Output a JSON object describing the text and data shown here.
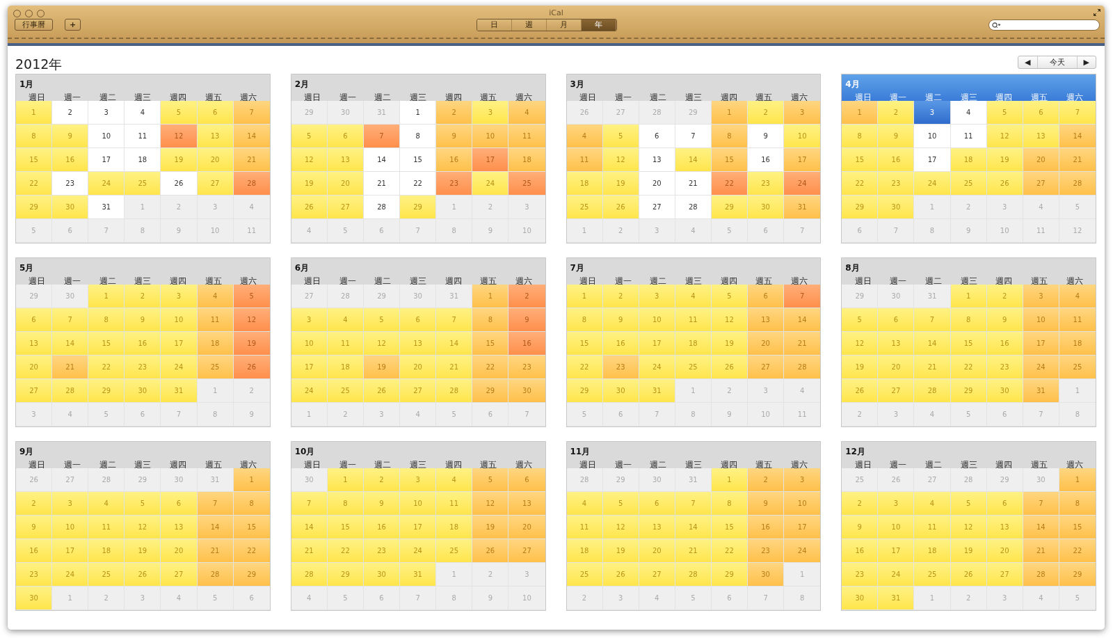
{
  "window": {
    "title": "iCal"
  },
  "toolbar": {
    "calendars_button": "行事曆",
    "add_button": "+",
    "views": [
      {
        "label": "日",
        "selected": false
      },
      {
        "label": "週",
        "selected": false
      },
      {
        "label": "月",
        "selected": false
      },
      {
        "label": "年",
        "selected": true
      }
    ]
  },
  "year_title": "2012年",
  "nav": {
    "prev": "◀",
    "today": "今天",
    "next": "▶"
  },
  "months": [
    {
      "title": "1月",
      "selected": false,
      "weekdays": [
        "週日",
        "週一",
        "週二",
        "週三",
        "週四",
        "週五",
        "週六"
      ],
      "days": [
        {
          "day": "1",
          "kind": "low"
        },
        {
          "day": "2",
          "kind": "free"
        },
        {
          "day": "3",
          "kind": "free"
        },
        {
          "day": "4",
          "kind": "free"
        },
        {
          "day": "5",
          "kind": "low"
        },
        {
          "day": "6",
          "kind": "low"
        },
        {
          "day": "7",
          "kind": "mid"
        },
        {
          "day": "8",
          "kind": "low"
        },
        {
          "day": "9",
          "kind": "low"
        },
        {
          "day": "10",
          "kind": "free"
        },
        {
          "day": "11",
          "kind": "free"
        },
        {
          "day": "12",
          "kind": "high"
        },
        {
          "day": "13",
          "kind": "low"
        },
        {
          "day": "14",
          "kind": "mid"
        },
        {
          "day": "15",
          "kind": "low"
        },
        {
          "day": "16",
          "kind": "low"
        },
        {
          "day": "17",
          "kind": "free"
        },
        {
          "day": "18",
          "kind": "free"
        },
        {
          "day": "19",
          "kind": "low"
        },
        {
          "day": "20",
          "kind": "low"
        },
        {
          "day": "21",
          "kind": "mid"
        },
        {
          "day": "22",
          "kind": "low"
        },
        {
          "day": "23",
          "kind": "free"
        },
        {
          "day": "24",
          "kind": "low"
        },
        {
          "day": "25",
          "kind": "low"
        },
        {
          "day": "26",
          "kind": "free"
        },
        {
          "day": "27",
          "kind": "low"
        },
        {
          "day": "28",
          "kind": "high"
        },
        {
          "day": "29",
          "kind": "low"
        },
        {
          "day": "30",
          "kind": "low"
        },
        {
          "day": "31",
          "kind": "free"
        },
        {
          "day": "1",
          "kind": "out"
        },
        {
          "day": "2",
          "kind": "out"
        },
        {
          "day": "3",
          "kind": "out"
        },
        {
          "day": "4",
          "kind": "out"
        },
        {
          "day": "5",
          "kind": "out"
        },
        {
          "day": "6",
          "kind": "out"
        },
        {
          "day": "7",
          "kind": "out"
        },
        {
          "day": "8",
          "kind": "out"
        },
        {
          "day": "9",
          "kind": "out"
        },
        {
          "day": "10",
          "kind": "out"
        },
        {
          "day": "11",
          "kind": "out"
        }
      ]
    },
    {
      "title": "2月",
      "selected": false,
      "weekdays": [
        "週日",
        "週一",
        "週二",
        "週三",
        "週四",
        "週五",
        "週六"
      ],
      "days": [
        {
          "day": "29",
          "kind": "out"
        },
        {
          "day": "30",
          "kind": "out"
        },
        {
          "day": "31",
          "kind": "out"
        },
        {
          "day": "1",
          "kind": "free"
        },
        {
          "day": "2",
          "kind": "mid"
        },
        {
          "day": "3",
          "kind": "low"
        },
        {
          "day": "4",
          "kind": "mid"
        },
        {
          "day": "5",
          "kind": "low"
        },
        {
          "day": "6",
          "kind": "low"
        },
        {
          "day": "7",
          "kind": "high"
        },
        {
          "day": "8",
          "kind": "free"
        },
        {
          "day": "9",
          "kind": "mid"
        },
        {
          "day": "10",
          "kind": "mid"
        },
        {
          "day": "11",
          "kind": "mid"
        },
        {
          "day": "12",
          "kind": "low"
        },
        {
          "day": "13",
          "kind": "low"
        },
        {
          "day": "14",
          "kind": "free"
        },
        {
          "day": "15",
          "kind": "free"
        },
        {
          "day": "16",
          "kind": "mid"
        },
        {
          "day": "17",
          "kind": "high"
        },
        {
          "day": "18",
          "kind": "mid"
        },
        {
          "day": "19",
          "kind": "low"
        },
        {
          "day": "20",
          "kind": "low"
        },
        {
          "day": "21",
          "kind": "free"
        },
        {
          "day": "22",
          "kind": "free"
        },
        {
          "day": "23",
          "kind": "high"
        },
        {
          "day": "24",
          "kind": "low"
        },
        {
          "day": "25",
          "kind": "high"
        },
        {
          "day": "26",
          "kind": "low"
        },
        {
          "day": "27",
          "kind": "low"
        },
        {
          "day": "28",
          "kind": "free"
        },
        {
          "day": "29",
          "kind": "low"
        },
        {
          "day": "1",
          "kind": "out"
        },
        {
          "day": "2",
          "kind": "out"
        },
        {
          "day": "3",
          "kind": "out"
        },
        {
          "day": "4",
          "kind": "out"
        },
        {
          "day": "5",
          "kind": "out"
        },
        {
          "day": "6",
          "kind": "out"
        },
        {
          "day": "7",
          "kind": "out"
        },
        {
          "day": "8",
          "kind": "out"
        },
        {
          "day": "9",
          "kind": "out"
        },
        {
          "day": "10",
          "kind": "out"
        }
      ]
    },
    {
      "title": "3月",
      "selected": false,
      "weekdays": [
        "週日",
        "週一",
        "週二",
        "週三",
        "週四",
        "週五",
        "週六"
      ],
      "days": [
        {
          "day": "26",
          "kind": "out"
        },
        {
          "day": "27",
          "kind": "out"
        },
        {
          "day": "28",
          "kind": "out"
        },
        {
          "day": "29",
          "kind": "out"
        },
        {
          "day": "1",
          "kind": "mid"
        },
        {
          "day": "2",
          "kind": "low"
        },
        {
          "day": "3",
          "kind": "mid"
        },
        {
          "day": "4",
          "kind": "mid"
        },
        {
          "day": "5",
          "kind": "low"
        },
        {
          "day": "6",
          "kind": "free"
        },
        {
          "day": "7",
          "kind": "free"
        },
        {
          "day": "8",
          "kind": "mid"
        },
        {
          "day": "9",
          "kind": "free"
        },
        {
          "day": "10",
          "kind": "low"
        },
        {
          "day": "11",
          "kind": "mid"
        },
        {
          "day": "12",
          "kind": "low"
        },
        {
          "day": "13",
          "kind": "free"
        },
        {
          "day": "14",
          "kind": "low"
        },
        {
          "day": "15",
          "kind": "mid"
        },
        {
          "day": "16",
          "kind": "free"
        },
        {
          "day": "17",
          "kind": "mid"
        },
        {
          "day": "18",
          "kind": "low"
        },
        {
          "day": "19",
          "kind": "low"
        },
        {
          "day": "20",
          "kind": "free"
        },
        {
          "day": "21",
          "kind": "free"
        },
        {
          "day": "22",
          "kind": "high"
        },
        {
          "day": "23",
          "kind": "low"
        },
        {
          "day": "24",
          "kind": "high"
        },
        {
          "day": "25",
          "kind": "low"
        },
        {
          "day": "26",
          "kind": "low"
        },
        {
          "day": "27",
          "kind": "free"
        },
        {
          "day": "28",
          "kind": "free"
        },
        {
          "day": "29",
          "kind": "low"
        },
        {
          "day": "30",
          "kind": "low"
        },
        {
          "day": "31",
          "kind": "mid"
        },
        {
          "day": "1",
          "kind": "out"
        },
        {
          "day": "2",
          "kind": "out"
        },
        {
          "day": "3",
          "kind": "out"
        },
        {
          "day": "4",
          "kind": "out"
        },
        {
          "day": "5",
          "kind": "out"
        },
        {
          "day": "6",
          "kind": "out"
        },
        {
          "day": "7",
          "kind": "out"
        }
      ]
    },
    {
      "title": "4月",
      "selected": true,
      "weekdays": [
        "週日",
        "週一",
        "週二",
        "週三",
        "週四",
        "週五",
        "週六"
      ],
      "days": [
        {
          "day": "1",
          "kind": "mid"
        },
        {
          "day": "2",
          "kind": "low"
        },
        {
          "day": "3",
          "kind": "today"
        },
        {
          "day": "4",
          "kind": "free"
        },
        {
          "day": "5",
          "kind": "low"
        },
        {
          "day": "6",
          "kind": "low"
        },
        {
          "day": "7",
          "kind": "low"
        },
        {
          "day": "8",
          "kind": "low"
        },
        {
          "day": "9",
          "kind": "low"
        },
        {
          "day": "10",
          "kind": "free"
        },
        {
          "day": "11",
          "kind": "free"
        },
        {
          "day": "12",
          "kind": "low"
        },
        {
          "day": "13",
          "kind": "low"
        },
        {
          "day": "14",
          "kind": "mid"
        },
        {
          "day": "15",
          "kind": "low"
        },
        {
          "day": "16",
          "kind": "low"
        },
        {
          "day": "17",
          "kind": "free"
        },
        {
          "day": "18",
          "kind": "low"
        },
        {
          "day": "19",
          "kind": "low"
        },
        {
          "day": "20",
          "kind": "mid"
        },
        {
          "day": "21",
          "kind": "mid"
        },
        {
          "day": "22",
          "kind": "low"
        },
        {
          "day": "23",
          "kind": "low"
        },
        {
          "day": "24",
          "kind": "low"
        },
        {
          "day": "25",
          "kind": "low"
        },
        {
          "day": "26",
          "kind": "low"
        },
        {
          "day": "27",
          "kind": "mid"
        },
        {
          "day": "28",
          "kind": "mid"
        },
        {
          "day": "29",
          "kind": "low"
        },
        {
          "day": "30",
          "kind": "low"
        },
        {
          "day": "1",
          "kind": "out"
        },
        {
          "day": "2",
          "kind": "out"
        },
        {
          "day": "3",
          "kind": "out"
        },
        {
          "day": "4",
          "kind": "out"
        },
        {
          "day": "5",
          "kind": "out"
        },
        {
          "day": "6",
          "kind": "out"
        },
        {
          "day": "7",
          "kind": "out"
        },
        {
          "day": "8",
          "kind": "out"
        },
        {
          "day": "9",
          "kind": "out"
        },
        {
          "day": "10",
          "kind": "out"
        },
        {
          "day": "11",
          "kind": "out"
        },
        {
          "day": "12",
          "kind": "out"
        }
      ]
    },
    {
      "title": "5月",
      "selected": false,
      "weekdays": [
        "週日",
        "週一",
        "週二",
        "週三",
        "週四",
        "週五",
        "週六"
      ],
      "days": [
        {
          "day": "29",
          "kind": "out"
        },
        {
          "day": "30",
          "kind": "out"
        },
        {
          "day": "1",
          "kind": "low"
        },
        {
          "day": "2",
          "kind": "low"
        },
        {
          "day": "3",
          "kind": "low"
        },
        {
          "day": "4",
          "kind": "mid"
        },
        {
          "day": "5",
          "kind": "high"
        },
        {
          "day": "6",
          "kind": "low"
        },
        {
          "day": "7",
          "kind": "low"
        },
        {
          "day": "8",
          "kind": "low"
        },
        {
          "day": "9",
          "kind": "low"
        },
        {
          "day": "10",
          "kind": "low"
        },
        {
          "day": "11",
          "kind": "mid"
        },
        {
          "day": "12",
          "kind": "high"
        },
        {
          "day": "13",
          "kind": "low"
        },
        {
          "day": "14",
          "kind": "low"
        },
        {
          "day": "15",
          "kind": "low"
        },
        {
          "day": "16",
          "kind": "low"
        },
        {
          "day": "17",
          "kind": "low"
        },
        {
          "day": "18",
          "kind": "mid"
        },
        {
          "day": "19",
          "kind": "high"
        },
        {
          "day": "20",
          "kind": "low"
        },
        {
          "day": "21",
          "kind": "mid"
        },
        {
          "day": "22",
          "kind": "low"
        },
        {
          "day": "23",
          "kind": "low"
        },
        {
          "day": "24",
          "kind": "low"
        },
        {
          "day": "25",
          "kind": "mid"
        },
        {
          "day": "26",
          "kind": "high"
        },
        {
          "day": "27",
          "kind": "low"
        },
        {
          "day": "28",
          "kind": "low"
        },
        {
          "day": "29",
          "kind": "low"
        },
        {
          "day": "30",
          "kind": "low"
        },
        {
          "day": "31",
          "kind": "low"
        },
        {
          "day": "1",
          "kind": "out"
        },
        {
          "day": "2",
          "kind": "out"
        },
        {
          "day": "3",
          "kind": "out"
        },
        {
          "day": "4",
          "kind": "out"
        },
        {
          "day": "5",
          "kind": "out"
        },
        {
          "day": "6",
          "kind": "out"
        },
        {
          "day": "7",
          "kind": "out"
        },
        {
          "day": "8",
          "kind": "out"
        },
        {
          "day": "9",
          "kind": "out"
        }
      ]
    },
    {
      "title": "6月",
      "selected": false,
      "weekdays": [
        "週日",
        "週一",
        "週二",
        "週三",
        "週四",
        "週五",
        "週六"
      ],
      "days": [
        {
          "day": "27",
          "kind": "out"
        },
        {
          "day": "28",
          "kind": "out"
        },
        {
          "day": "29",
          "kind": "out"
        },
        {
          "day": "30",
          "kind": "out"
        },
        {
          "day": "31",
          "kind": "out"
        },
        {
          "day": "1",
          "kind": "mid"
        },
        {
          "day": "2",
          "kind": "high"
        },
        {
          "day": "3",
          "kind": "low"
        },
        {
          "day": "4",
          "kind": "low"
        },
        {
          "day": "5",
          "kind": "low"
        },
        {
          "day": "6",
          "kind": "low"
        },
        {
          "day": "7",
          "kind": "low"
        },
        {
          "day": "8",
          "kind": "mid"
        },
        {
          "day": "9",
          "kind": "high"
        },
        {
          "day": "10",
          "kind": "low"
        },
        {
          "day": "11",
          "kind": "low"
        },
        {
          "day": "12",
          "kind": "low"
        },
        {
          "day": "13",
          "kind": "low"
        },
        {
          "day": "14",
          "kind": "low"
        },
        {
          "day": "15",
          "kind": "mid"
        },
        {
          "day": "16",
          "kind": "high"
        },
        {
          "day": "17",
          "kind": "low"
        },
        {
          "day": "18",
          "kind": "low"
        },
        {
          "day": "19",
          "kind": "mid"
        },
        {
          "day": "20",
          "kind": "low"
        },
        {
          "day": "21",
          "kind": "low"
        },
        {
          "day": "22",
          "kind": "mid"
        },
        {
          "day": "23",
          "kind": "mid"
        },
        {
          "day": "24",
          "kind": "low"
        },
        {
          "day": "25",
          "kind": "low"
        },
        {
          "day": "26",
          "kind": "low"
        },
        {
          "day": "27",
          "kind": "low"
        },
        {
          "day": "28",
          "kind": "low"
        },
        {
          "day": "29",
          "kind": "mid"
        },
        {
          "day": "30",
          "kind": "mid"
        },
        {
          "day": "1",
          "kind": "out"
        },
        {
          "day": "2",
          "kind": "out"
        },
        {
          "day": "3",
          "kind": "out"
        },
        {
          "day": "4",
          "kind": "out"
        },
        {
          "day": "5",
          "kind": "out"
        },
        {
          "day": "6",
          "kind": "out"
        },
        {
          "day": "7",
          "kind": "out"
        }
      ]
    },
    {
      "title": "7月",
      "selected": false,
      "weekdays": [
        "週日",
        "週一",
        "週二",
        "週三",
        "週四",
        "週五",
        "週六"
      ],
      "days": [
        {
          "day": "1",
          "kind": "low"
        },
        {
          "day": "2",
          "kind": "low"
        },
        {
          "day": "3",
          "kind": "low"
        },
        {
          "day": "4",
          "kind": "low"
        },
        {
          "day": "5",
          "kind": "low"
        },
        {
          "day": "6",
          "kind": "mid"
        },
        {
          "day": "7",
          "kind": "high"
        },
        {
          "day": "8",
          "kind": "low"
        },
        {
          "day": "9",
          "kind": "low"
        },
        {
          "day": "10",
          "kind": "low"
        },
        {
          "day": "11",
          "kind": "low"
        },
        {
          "day": "12",
          "kind": "low"
        },
        {
          "day": "13",
          "kind": "mid"
        },
        {
          "day": "14",
          "kind": "mid"
        },
        {
          "day": "15",
          "kind": "low"
        },
        {
          "day": "16",
          "kind": "low"
        },
        {
          "day": "17",
          "kind": "low"
        },
        {
          "day": "18",
          "kind": "low"
        },
        {
          "day": "19",
          "kind": "low"
        },
        {
          "day": "20",
          "kind": "mid"
        },
        {
          "day": "21",
          "kind": "mid"
        },
        {
          "day": "22",
          "kind": "low"
        },
        {
          "day": "23",
          "kind": "mid"
        },
        {
          "day": "24",
          "kind": "low"
        },
        {
          "day": "25",
          "kind": "low"
        },
        {
          "day": "26",
          "kind": "low"
        },
        {
          "day": "27",
          "kind": "mid"
        },
        {
          "day": "28",
          "kind": "mid"
        },
        {
          "day": "29",
          "kind": "low"
        },
        {
          "day": "30",
          "kind": "low"
        },
        {
          "day": "31",
          "kind": "low"
        },
        {
          "day": "1",
          "kind": "out"
        },
        {
          "day": "2",
          "kind": "out"
        },
        {
          "day": "3",
          "kind": "out"
        },
        {
          "day": "4",
          "kind": "out"
        },
        {
          "day": "5",
          "kind": "out"
        },
        {
          "day": "6",
          "kind": "out"
        },
        {
          "day": "7",
          "kind": "out"
        },
        {
          "day": "8",
          "kind": "out"
        },
        {
          "day": "9",
          "kind": "out"
        },
        {
          "day": "10",
          "kind": "out"
        },
        {
          "day": "11",
          "kind": "out"
        }
      ]
    },
    {
      "title": "8月",
      "selected": false,
      "weekdays": [
        "週日",
        "週一",
        "週二",
        "週三",
        "週四",
        "週五",
        "週六"
      ],
      "days": [
        {
          "day": "29",
          "kind": "out"
        },
        {
          "day": "30",
          "kind": "out"
        },
        {
          "day": "31",
          "kind": "out"
        },
        {
          "day": "1",
          "kind": "low"
        },
        {
          "day": "2",
          "kind": "low"
        },
        {
          "day": "3",
          "kind": "mid"
        },
        {
          "day": "4",
          "kind": "mid"
        },
        {
          "day": "5",
          "kind": "low"
        },
        {
          "day": "6",
          "kind": "low"
        },
        {
          "day": "7",
          "kind": "low"
        },
        {
          "day": "8",
          "kind": "low"
        },
        {
          "day": "9",
          "kind": "low"
        },
        {
          "day": "10",
          "kind": "mid"
        },
        {
          "day": "11",
          "kind": "mid"
        },
        {
          "day": "12",
          "kind": "low"
        },
        {
          "day": "13",
          "kind": "low"
        },
        {
          "day": "14",
          "kind": "low"
        },
        {
          "day": "15",
          "kind": "low"
        },
        {
          "day": "16",
          "kind": "low"
        },
        {
          "day": "17",
          "kind": "mid"
        },
        {
          "day": "18",
          "kind": "mid"
        },
        {
          "day": "19",
          "kind": "low"
        },
        {
          "day": "20",
          "kind": "low"
        },
        {
          "day": "21",
          "kind": "low"
        },
        {
          "day": "22",
          "kind": "low"
        },
        {
          "day": "23",
          "kind": "low"
        },
        {
          "day": "24",
          "kind": "mid"
        },
        {
          "day": "25",
          "kind": "mid"
        },
        {
          "day": "26",
          "kind": "low"
        },
        {
          "day": "27",
          "kind": "low"
        },
        {
          "day": "28",
          "kind": "low"
        },
        {
          "day": "29",
          "kind": "low"
        },
        {
          "day": "30",
          "kind": "low"
        },
        {
          "day": "31",
          "kind": "mid"
        },
        {
          "day": "1",
          "kind": "out"
        },
        {
          "day": "2",
          "kind": "out"
        },
        {
          "day": "3",
          "kind": "out"
        },
        {
          "day": "4",
          "kind": "out"
        },
        {
          "day": "5",
          "kind": "out"
        },
        {
          "day": "6",
          "kind": "out"
        },
        {
          "day": "7",
          "kind": "out"
        },
        {
          "day": "8",
          "kind": "out"
        }
      ]
    },
    {
      "title": "9月",
      "selected": false,
      "weekdays": [
        "週日",
        "週一",
        "週二",
        "週三",
        "週四",
        "週五",
        "週六"
      ],
      "days": [
        {
          "day": "26",
          "kind": "out"
        },
        {
          "day": "27",
          "kind": "out"
        },
        {
          "day": "28",
          "kind": "out"
        },
        {
          "day": "29",
          "kind": "out"
        },
        {
          "day": "30",
          "kind": "out"
        },
        {
          "day": "31",
          "kind": "out"
        },
        {
          "day": "1",
          "kind": "mid"
        },
        {
          "day": "2",
          "kind": "low"
        },
        {
          "day": "3",
          "kind": "low"
        },
        {
          "day": "4",
          "kind": "low"
        },
        {
          "day": "5",
          "kind": "low"
        },
        {
          "day": "6",
          "kind": "low"
        },
        {
          "day": "7",
          "kind": "mid"
        },
        {
          "day": "8",
          "kind": "mid"
        },
        {
          "day": "9",
          "kind": "low"
        },
        {
          "day": "10",
          "kind": "low"
        },
        {
          "day": "11",
          "kind": "low"
        },
        {
          "day": "12",
          "kind": "low"
        },
        {
          "day": "13",
          "kind": "low"
        },
        {
          "day": "14",
          "kind": "mid"
        },
        {
          "day": "15",
          "kind": "mid"
        },
        {
          "day": "16",
          "kind": "low"
        },
        {
          "day": "17",
          "kind": "low"
        },
        {
          "day": "18",
          "kind": "low"
        },
        {
          "day": "19",
          "kind": "low"
        },
        {
          "day": "20",
          "kind": "low"
        },
        {
          "day": "21",
          "kind": "mid"
        },
        {
          "day": "22",
          "kind": "mid"
        },
        {
          "day": "23",
          "kind": "low"
        },
        {
          "day": "24",
          "kind": "low"
        },
        {
          "day": "25",
          "kind": "low"
        },
        {
          "day": "26",
          "kind": "low"
        },
        {
          "day": "27",
          "kind": "low"
        },
        {
          "day": "28",
          "kind": "mid"
        },
        {
          "day": "29",
          "kind": "mid"
        },
        {
          "day": "30",
          "kind": "low"
        },
        {
          "day": "1",
          "kind": "out"
        },
        {
          "day": "2",
          "kind": "out"
        },
        {
          "day": "3",
          "kind": "out"
        },
        {
          "day": "4",
          "kind": "out"
        },
        {
          "day": "5",
          "kind": "out"
        },
        {
          "day": "6",
          "kind": "out"
        }
      ]
    },
    {
      "title": "10月",
      "selected": false,
      "weekdays": [
        "週日",
        "週一",
        "週二",
        "週三",
        "週四",
        "週五",
        "週六"
      ],
      "days": [
        {
          "day": "30",
          "kind": "out"
        },
        {
          "day": "1",
          "kind": "low"
        },
        {
          "day": "2",
          "kind": "low"
        },
        {
          "day": "3",
          "kind": "low"
        },
        {
          "day": "4",
          "kind": "low"
        },
        {
          "day": "5",
          "kind": "mid"
        },
        {
          "day": "6",
          "kind": "mid"
        },
        {
          "day": "7",
          "kind": "low"
        },
        {
          "day": "8",
          "kind": "low"
        },
        {
          "day": "9",
          "kind": "low"
        },
        {
          "day": "10",
          "kind": "low"
        },
        {
          "day": "11",
          "kind": "low"
        },
        {
          "day": "12",
          "kind": "mid"
        },
        {
          "day": "13",
          "kind": "mid"
        },
        {
          "day": "14",
          "kind": "low"
        },
        {
          "day": "15",
          "kind": "low"
        },
        {
          "day": "16",
          "kind": "low"
        },
        {
          "day": "17",
          "kind": "low"
        },
        {
          "day": "18",
          "kind": "low"
        },
        {
          "day": "19",
          "kind": "mid"
        },
        {
          "day": "20",
          "kind": "mid"
        },
        {
          "day": "21",
          "kind": "low"
        },
        {
          "day": "22",
          "kind": "low"
        },
        {
          "day": "23",
          "kind": "low"
        },
        {
          "day": "24",
          "kind": "low"
        },
        {
          "day": "25",
          "kind": "low"
        },
        {
          "day": "26",
          "kind": "mid"
        },
        {
          "day": "27",
          "kind": "mid"
        },
        {
          "day": "28",
          "kind": "low"
        },
        {
          "day": "29",
          "kind": "low"
        },
        {
          "day": "30",
          "kind": "low"
        },
        {
          "day": "31",
          "kind": "low"
        },
        {
          "day": "1",
          "kind": "out"
        },
        {
          "day": "2",
          "kind": "out"
        },
        {
          "day": "3",
          "kind": "out"
        },
        {
          "day": "4",
          "kind": "out"
        },
        {
          "day": "5",
          "kind": "out"
        },
        {
          "day": "6",
          "kind": "out"
        },
        {
          "day": "7",
          "kind": "out"
        },
        {
          "day": "8",
          "kind": "out"
        },
        {
          "day": "9",
          "kind": "out"
        },
        {
          "day": "10",
          "kind": "out"
        }
      ]
    },
    {
      "title": "11月",
      "selected": false,
      "weekdays": [
        "週日",
        "週一",
        "週二",
        "週三",
        "週四",
        "週五",
        "週六"
      ],
      "days": [
        {
          "day": "28",
          "kind": "out"
        },
        {
          "day": "29",
          "kind": "out"
        },
        {
          "day": "30",
          "kind": "out"
        },
        {
          "day": "31",
          "kind": "out"
        },
        {
          "day": "1",
          "kind": "low"
        },
        {
          "day": "2",
          "kind": "mid"
        },
        {
          "day": "3",
          "kind": "mid"
        },
        {
          "day": "4",
          "kind": "low"
        },
        {
          "day": "5",
          "kind": "low"
        },
        {
          "day": "6",
          "kind": "low"
        },
        {
          "day": "7",
          "kind": "low"
        },
        {
          "day": "8",
          "kind": "low"
        },
        {
          "day": "9",
          "kind": "mid"
        },
        {
          "day": "10",
          "kind": "mid"
        },
        {
          "day": "11",
          "kind": "low"
        },
        {
          "day": "12",
          "kind": "low"
        },
        {
          "day": "13",
          "kind": "low"
        },
        {
          "day": "14",
          "kind": "low"
        },
        {
          "day": "15",
          "kind": "low"
        },
        {
          "day": "16",
          "kind": "mid"
        },
        {
          "day": "17",
          "kind": "mid"
        },
        {
          "day": "18",
          "kind": "low"
        },
        {
          "day": "19",
          "kind": "low"
        },
        {
          "day": "20",
          "kind": "low"
        },
        {
          "day": "21",
          "kind": "low"
        },
        {
          "day": "22",
          "kind": "low"
        },
        {
          "day": "23",
          "kind": "mid"
        },
        {
          "day": "24",
          "kind": "mid"
        },
        {
          "day": "25",
          "kind": "low"
        },
        {
          "day": "26",
          "kind": "low"
        },
        {
          "day": "27",
          "kind": "low"
        },
        {
          "day": "28",
          "kind": "low"
        },
        {
          "day": "29",
          "kind": "low"
        },
        {
          "day": "30",
          "kind": "mid"
        },
        {
          "day": "1",
          "kind": "out"
        },
        {
          "day": "2",
          "kind": "out"
        },
        {
          "day": "3",
          "kind": "out"
        },
        {
          "day": "4",
          "kind": "out"
        },
        {
          "day": "5",
          "kind": "out"
        },
        {
          "day": "6",
          "kind": "out"
        },
        {
          "day": "7",
          "kind": "out"
        },
        {
          "day": "8",
          "kind": "out"
        }
      ]
    },
    {
      "title": "12月",
      "selected": false,
      "weekdays": [
        "週日",
        "週一",
        "週二",
        "週三",
        "週四",
        "週五",
        "週六"
      ],
      "days": [
        {
          "day": "25",
          "kind": "out"
        },
        {
          "day": "26",
          "kind": "out"
        },
        {
          "day": "27",
          "kind": "out"
        },
        {
          "day": "28",
          "kind": "out"
        },
        {
          "day": "29",
          "kind": "out"
        },
        {
          "day": "30",
          "kind": "out"
        },
        {
          "day": "1",
          "kind": "mid"
        },
        {
          "day": "2",
          "kind": "low"
        },
        {
          "day": "3",
          "kind": "low"
        },
        {
          "day": "4",
          "kind": "low"
        },
        {
          "day": "5",
          "kind": "low"
        },
        {
          "day": "6",
          "kind": "low"
        },
        {
          "day": "7",
          "kind": "mid"
        },
        {
          "day": "8",
          "kind": "mid"
        },
        {
          "day": "9",
          "kind": "low"
        },
        {
          "day": "10",
          "kind": "low"
        },
        {
          "day": "11",
          "kind": "low"
        },
        {
          "day": "12",
          "kind": "low"
        },
        {
          "day": "13",
          "kind": "low"
        },
        {
          "day": "14",
          "kind": "mid"
        },
        {
          "day": "15",
          "kind": "mid"
        },
        {
          "day": "16",
          "kind": "low"
        },
        {
          "day": "17",
          "kind": "low"
        },
        {
          "day": "18",
          "kind": "low"
        },
        {
          "day": "19",
          "kind": "low"
        },
        {
          "day": "20",
          "kind": "low"
        },
        {
          "day": "21",
          "kind": "mid"
        },
        {
          "day": "22",
          "kind": "mid"
        },
        {
          "day": "23",
          "kind": "low"
        },
        {
          "day": "24",
          "kind": "low"
        },
        {
          "day": "25",
          "kind": "low"
        },
        {
          "day": "26",
          "kind": "low"
        },
        {
          "day": "27",
          "kind": "low"
        },
        {
          "day": "28",
          "kind": "mid"
        },
        {
          "day": "29",
          "kind": "mid"
        },
        {
          "day": "30",
          "kind": "low"
        },
        {
          "day": "31",
          "kind": "low"
        },
        {
          "day": "1",
          "kind": "out"
        },
        {
          "day": "2",
          "kind": "out"
        },
        {
          "day": "3",
          "kind": "out"
        },
        {
          "day": "4",
          "kind": "out"
        },
        {
          "day": "5",
          "kind": "out"
        }
      ]
    }
  ]
}
